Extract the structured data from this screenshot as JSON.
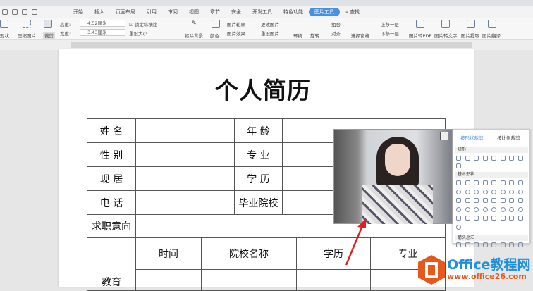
{
  "menu": {
    "tabs": [
      "开始",
      "插入",
      "页面布局",
      "引用",
      "审阅",
      "视图",
      "章节",
      "安全",
      "开发工具",
      "特色功能",
      "图片工具"
    ],
    "search": "查找",
    "active": "图片工具"
  },
  "ribbon": {
    "shape": "形状",
    "compress": "压缩图片",
    "crop": "裁剪",
    "height_label": "高度:",
    "height_value": "4.52厘米",
    "width_label": "宽度:",
    "width_value": "3.43厘米",
    "lock_ratio": "锁定纵横比",
    "reset_size": "重设大小",
    "remove_bg": "抠除背景",
    "color": "颜色",
    "outline": "图片轮廓",
    "effect": "图片效果",
    "change": "更改图片",
    "reset": "重设图片",
    "wrap": "环绕",
    "rotate": "旋转",
    "group": "组合",
    "align": "对齐",
    "selection": "选择窗格",
    "up": "上移一层",
    "down": "下移一层",
    "to_pdf": "图片转PDF",
    "to_text": "图片转文字",
    "extract": "图片提取",
    "translate": "图片翻译"
  },
  "doc": {
    "title": "个人简历",
    "rows": [
      [
        "姓 名",
        "年 龄"
      ],
      [
        "性 别",
        "专 业"
      ],
      [
        "现 居",
        "学 历"
      ],
      [
        "电 话",
        "毕业院校"
      ]
    ],
    "intent": "求职意向",
    "edu": "教育",
    "edu_headers": [
      "时间",
      "院校名称",
      "学历",
      "专业"
    ]
  },
  "panel": {
    "tab1": "按形状裁剪",
    "tab2": "按比例裁剪",
    "sec1": "矩形",
    "sec2": "基本形状",
    "sec3": "箭头总汇"
  },
  "watermark": {
    "brand": "Office教程网",
    "url": "www.office26.com"
  },
  "colors": {
    "accent": "#4a90e2",
    "wm_orange": "#e8571b",
    "wm_blue": "#1b8fe0"
  }
}
